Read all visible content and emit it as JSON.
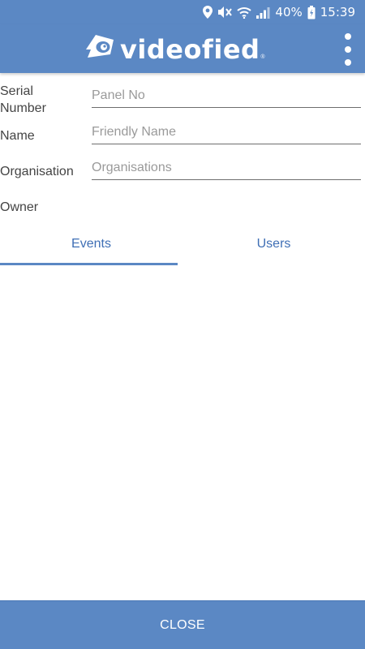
{
  "status_bar": {
    "battery": "40%",
    "time": "15:39",
    "icons": [
      "location-icon",
      "mute-icon",
      "wifi-icon",
      "signal-icon",
      "battery-charging-icon"
    ]
  },
  "app_bar": {
    "logo_text": "videofied",
    "logo_mark": "®",
    "menu_icon": "more-vertical-icon",
    "color": "#5b88c4"
  },
  "form": {
    "serial_number": {
      "label": "Serial Number",
      "placeholder": "Panel No",
      "value": ""
    },
    "name": {
      "label": "Name",
      "placeholder": "Friendly Name",
      "value": ""
    },
    "organisation": {
      "label": "Organisation",
      "placeholder": "Organisations",
      "value": ""
    },
    "owner": {
      "label": "Owner"
    }
  },
  "tabs": [
    {
      "label": "Events",
      "selected": true
    },
    {
      "label": "Users",
      "selected": false
    }
  ],
  "footer": {
    "close_label": "CLOSE"
  },
  "colors": {
    "accent": "#5b88c4",
    "tab_text": "#3f6fb5"
  }
}
